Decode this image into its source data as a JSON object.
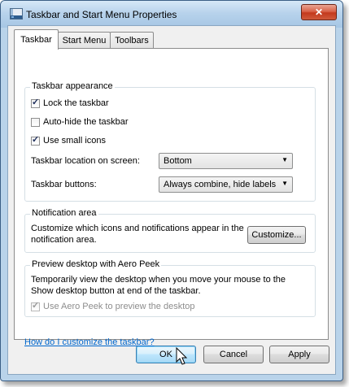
{
  "window": {
    "title": "Taskbar and Start Menu Properties",
    "close_glyph": "✕",
    "icon": "taskbar-properties-icon"
  },
  "tabs": [
    {
      "label": "Taskbar",
      "active": true
    },
    {
      "label": "Start Menu",
      "active": false
    },
    {
      "label": "Toolbars",
      "active": false
    }
  ],
  "appearance": {
    "title": "Taskbar appearance",
    "lock": {
      "label": "Lock the taskbar",
      "checked": true
    },
    "autohide": {
      "label": "Auto-hide the taskbar",
      "checked": false
    },
    "small_icons": {
      "label": "Use small icons",
      "checked": true
    },
    "location_label": "Taskbar location on screen:",
    "location_value": "Bottom",
    "buttons_label": "Taskbar buttons:",
    "buttons_value": "Always combine, hide labels"
  },
  "notification": {
    "title": "Notification area",
    "description": "Customize which icons and notifications appear in the notification area.",
    "desc_line1": "Customize which icons and notifications appear in the",
    "desc_line2": "notification area.",
    "customize_label": "Customize..."
  },
  "peek": {
    "title": "Preview desktop with Aero Peek",
    "desc_line1": "Temporarily view the desktop when you move your mouse to the",
    "desc_line2": "Show desktop button at end of the taskbar.",
    "checkbox": {
      "label": "Use Aero Peek to preview the desktop",
      "checked": true,
      "disabled": true
    }
  },
  "help_link": "How do I customize the taskbar?",
  "buttons": {
    "ok": "OK",
    "cancel": "Cancel",
    "apply": "Apply"
  },
  "colors": {
    "link": "#0066cc",
    "close_button": "#c3391d",
    "default_button_border": "#3c7fb1"
  }
}
